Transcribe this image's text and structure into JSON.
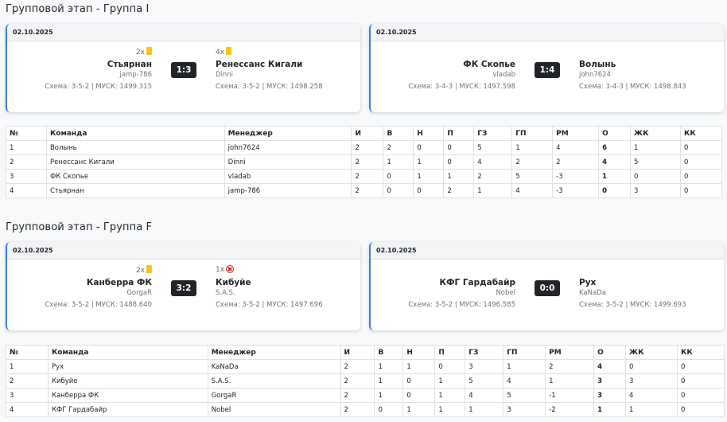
{
  "groups": [
    {
      "title": "Групповой этап - Группа I",
      "matches": [
        {
          "date": "02.10.2025",
          "score": "1:3",
          "home": {
            "cards": "2x",
            "card_type": "yellow",
            "team": "Стьярнан",
            "manager": "jamp-786",
            "meta": "Схема: 3-5-2 | МУСК: 1499.315"
          },
          "away": {
            "cards": "4x",
            "card_type": "yellow",
            "team": "Ренессанс Кигали",
            "manager": "Dinni",
            "meta": "Схема: 3-5-2 | МУСК: 1498.258"
          }
        },
        {
          "date": "02.10.2025",
          "score": "1:4",
          "home": {
            "cards": "",
            "card_type": "",
            "team": "ФК Скопье",
            "manager": "vladab",
            "meta": "Схема: 3-4-3 | МУСК: 1497.598"
          },
          "away": {
            "cards": "",
            "card_type": "",
            "team": "Волынь",
            "manager": "john7624",
            "meta": "Схема: 3-4-3 | МУСК: 1498.843"
          }
        }
      ],
      "table": {
        "headers": [
          "№",
          "Команда",
          "Менеджер",
          "И",
          "В",
          "Н",
          "П",
          "ГЗ",
          "ГП",
          "РМ",
          "О",
          "ЖК",
          "КК"
        ],
        "rows": [
          [
            "1",
            "Волынь",
            "john7624",
            "2",
            "2",
            "0",
            "0",
            "5",
            "1",
            "4",
            "6",
            "1",
            "0"
          ],
          [
            "2",
            "Ренессанс Кигали",
            "Dinni",
            "2",
            "1",
            "1",
            "0",
            "4",
            "2",
            "2",
            "4",
            "5",
            "0"
          ],
          [
            "3",
            "ФК Скопье",
            "vladab",
            "2",
            "0",
            "1",
            "1",
            "2",
            "5",
            "-3",
            "1",
            "0",
            "0"
          ],
          [
            "4",
            "Стьярнан",
            "jamp-786",
            "2",
            "0",
            "0",
            "2",
            "1",
            "4",
            "-3",
            "0",
            "3",
            "0"
          ]
        ]
      }
    },
    {
      "title": "Групповой этап - Группа F",
      "matches": [
        {
          "date": "02.10.2025",
          "score": "3:2",
          "home": {
            "cards": "2x",
            "card_type": "yellow",
            "team": "Канберра ФК",
            "manager": "GorgaR",
            "meta": "Схема: 3-5-2 | МУСК: 1488.640"
          },
          "away": {
            "cards": "1x",
            "card_type": "red",
            "team": "Кибуйе",
            "manager": "S.A.S.",
            "meta": "Схема: 3-5-2 | МУСК: 1497.696"
          }
        },
        {
          "date": "02.10.2025",
          "score": "0:0",
          "home": {
            "cards": "",
            "card_type": "",
            "team": "КФГ Гардабайр",
            "manager": "Nobel",
            "meta": "Схема: 3-5-2 | МУСК: 1496.585"
          },
          "away": {
            "cards": "",
            "card_type": "",
            "team": "Рух",
            "manager": "KaNaDa",
            "meta": "Схема: 3-5-2 | МУСК: 1499.693"
          }
        }
      ],
      "table": {
        "headers": [
          "№",
          "Команда",
          "Менеджер",
          "И",
          "В",
          "Н",
          "П",
          "ГЗ",
          "ГП",
          "РМ",
          "О",
          "ЖК",
          "КК"
        ],
        "rows": [
          [
            "1",
            "Рух",
            "KaNaDa",
            "2",
            "1",
            "1",
            "0",
            "3",
            "1",
            "2",
            "4",
            "0",
            "0"
          ],
          [
            "2",
            "Кибуйе",
            "S.A.S.",
            "2",
            "1",
            "0",
            "1",
            "5",
            "4",
            "1",
            "3",
            "3",
            "0"
          ],
          [
            "3",
            "Канберра ФК",
            "GorgaR",
            "2",
            "1",
            "0",
            "1",
            "4",
            "5",
            "-1",
            "3",
            "4",
            "0"
          ],
          [
            "4",
            "КФГ Гардабайр",
            "Nobel",
            "2",
            "0",
            "1",
            "1",
            "1",
            "3",
            "-2",
            "1",
            "1",
            "0"
          ]
        ]
      }
    }
  ]
}
